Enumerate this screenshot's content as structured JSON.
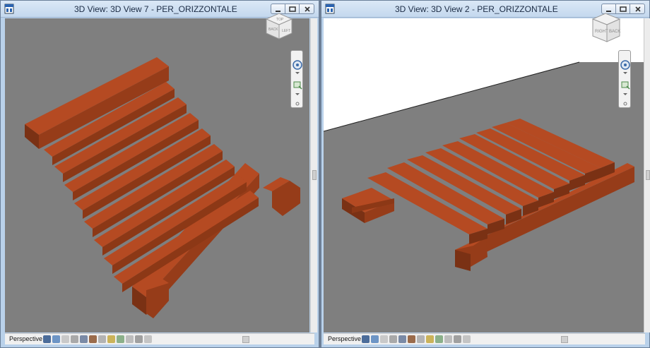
{
  "windows": [
    {
      "title": "3D View: 3D View 7 - PER_ORIZZONTALE",
      "status": {
        "view_mode": "Perspective"
      },
      "viewcube": {
        "faces": [
          "TOP",
          "LEFT",
          "BACK"
        ]
      }
    },
    {
      "title": "3D View: 3D View 2 - PER_ORIZZONTALE",
      "status": {
        "view_mode": "Perspective"
      },
      "viewcube": {
        "faces": [
          "RIGHT",
          "BACK"
        ]
      }
    }
  ],
  "colors": {
    "wood": "#a0421c",
    "wood_top": "#b54a22",
    "wood_dark": "#6e2c12",
    "background_gray": "#7f7f7f",
    "sky_white": "#ffffff"
  },
  "icons": [
    "app-icon",
    "minimize-icon",
    "restore-icon",
    "close-icon",
    "steering-wheel-icon",
    "zoom-icon"
  ]
}
